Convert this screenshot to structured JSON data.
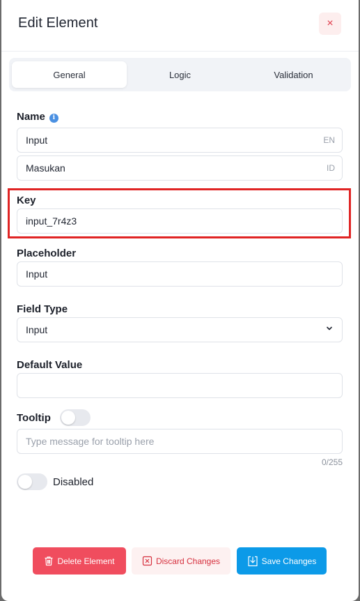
{
  "header": {
    "title": "Edit Element",
    "close_icon": "×"
  },
  "tabs": [
    {
      "label": "General",
      "active": true
    },
    {
      "label": "Logic",
      "active": false
    },
    {
      "label": "Validation",
      "active": false
    }
  ],
  "name": {
    "label": "Name",
    "info_icon": "i",
    "fields": [
      {
        "value": "Input",
        "lang": "EN"
      },
      {
        "value": "Masukan",
        "lang": "ID"
      }
    ]
  },
  "key": {
    "label": "Key",
    "value": "input_7r4z3"
  },
  "placeholder": {
    "label": "Placeholder",
    "value": "Input"
  },
  "field_type": {
    "label": "Field Type",
    "value": "Input"
  },
  "default_value": {
    "label": "Default Value",
    "value": ""
  },
  "tooltip": {
    "label": "Tooltip",
    "enabled": false,
    "placeholder": "Type message for tooltip here",
    "counter": "0/255"
  },
  "disabled": {
    "label": "Disabled",
    "enabled": false
  },
  "actions": {
    "delete_label": "Delete Element",
    "discard_label": "Discard Changes",
    "save_label": "Save Changes"
  },
  "colors": {
    "highlight": "#e02424",
    "delete": "#f04d5e",
    "discard_text": "#d6303e",
    "save": "#0c9ae8",
    "info": "#4a90e2"
  }
}
